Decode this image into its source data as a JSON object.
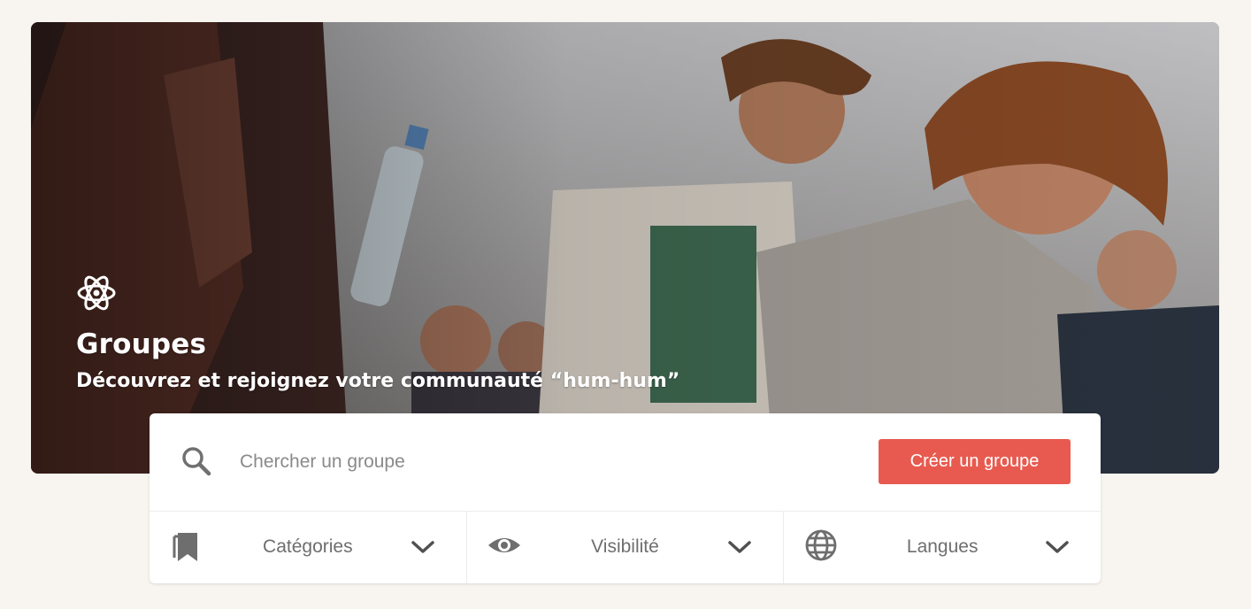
{
  "hero": {
    "title": "Groupes",
    "subtitle": "Découvrez et rejoignez votre communauté “hum-hum”",
    "icon": "atom-icon"
  },
  "search": {
    "placeholder": "Chercher un groupe",
    "value": "",
    "icon": "search-icon"
  },
  "actions": {
    "create_label": "Créer un groupe"
  },
  "filters": [
    {
      "label": "Catégories",
      "icon": "bookmarks-icon"
    },
    {
      "label": "Visibilité",
      "icon": "eye-icon"
    },
    {
      "label": "Langues",
      "icon": "globe-icon"
    }
  ],
  "colors": {
    "accent": "#e85a4f",
    "background": "#f8f5f0",
    "icon_gray": "#6e6e6e"
  }
}
